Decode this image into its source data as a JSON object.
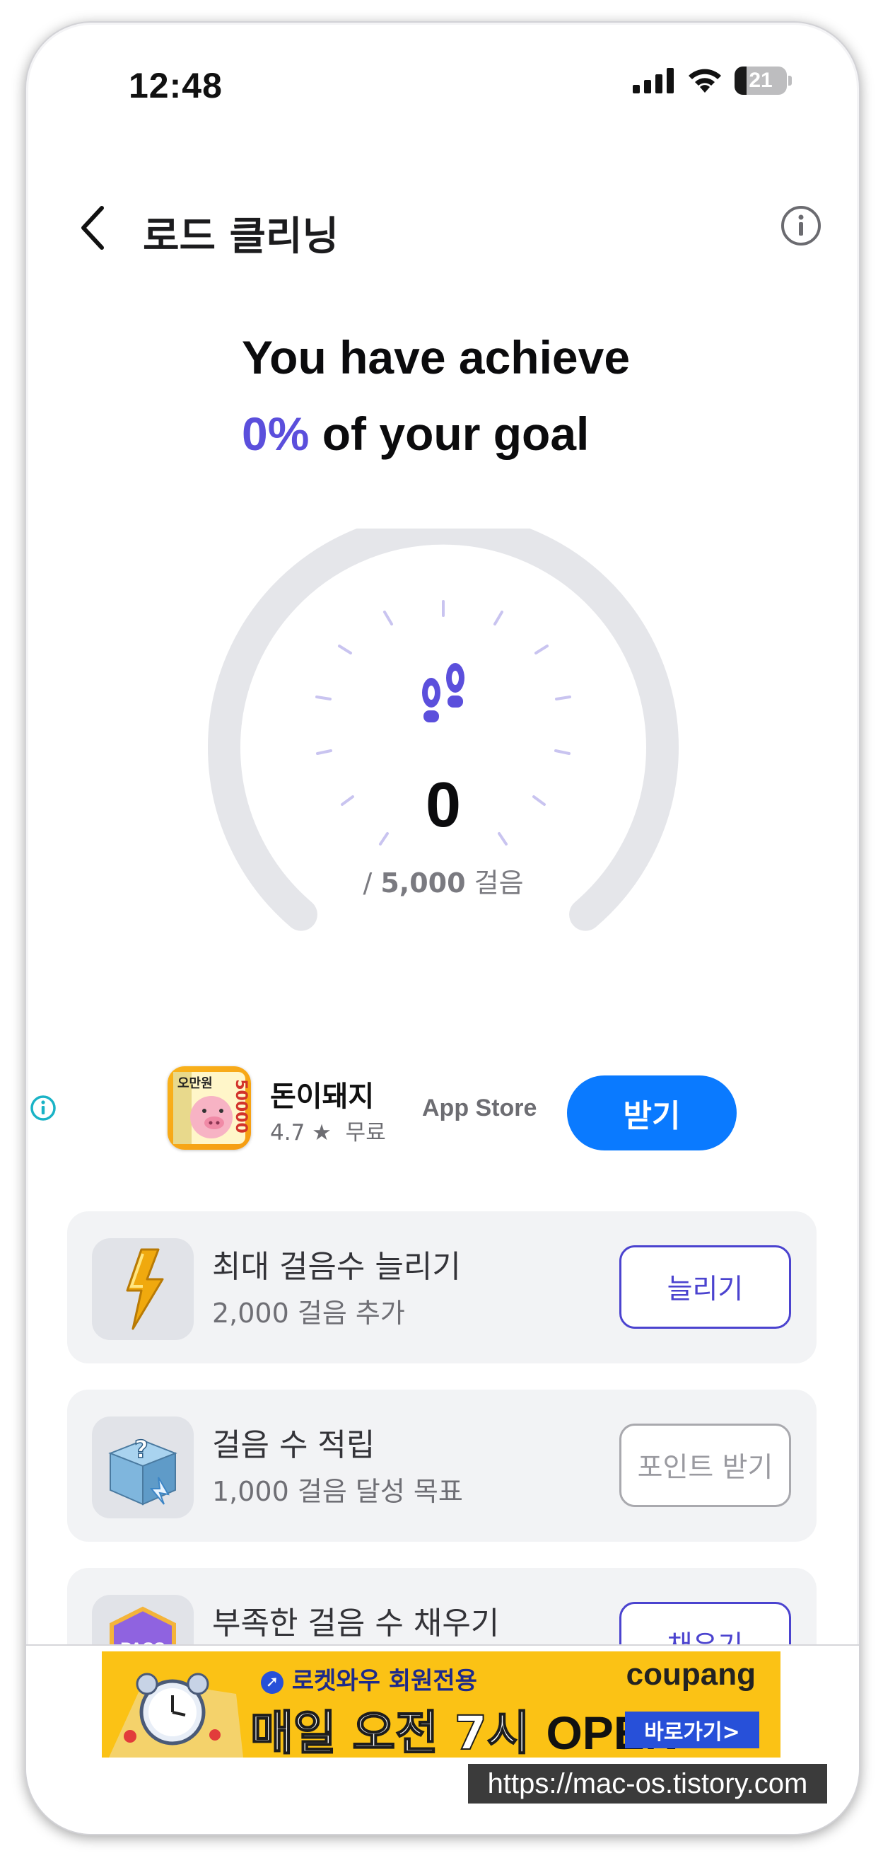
{
  "status": {
    "time": "12:48",
    "battery": "21"
  },
  "nav": {
    "title": "로드 클리닝"
  },
  "headline": {
    "line1": "You have achieve",
    "percent": "0%",
    "line2_rest": " of your goal"
  },
  "gauge": {
    "steps": "0",
    "goal_prefix": "/ ",
    "goal_value": "5,000",
    "goal_unit": " 걸음",
    "progress": 0
  },
  "ad": {
    "app_name": "돈이돼지",
    "rating": "4.7 ★",
    "price": "무료",
    "store": "App Store",
    "get_label": "받기",
    "icon_label_top": "오만원",
    "icon_label_side": "50000"
  },
  "cards": [
    {
      "title": "최대 걸음수 늘리기",
      "subtitle": "2,000 걸음 추가",
      "button": "늘리기",
      "icon": "lightning-icon"
    },
    {
      "title": "걸음 수 적립",
      "subtitle": "1,000 걸음 달성 목표",
      "button": "포인트 받기",
      "icon": "mystery-box-icon"
    },
    {
      "title": "부족한 걸음 수 채우기",
      "subtitle": "",
      "button": "채우기",
      "icon": "pass-badge-icon",
      "badge_text": "PASS"
    }
  ],
  "banner": {
    "top_text": "로켓와우 회원전용",
    "brand": "coupang",
    "main_text": "매일 오전 7시",
    "open": "OPEN",
    "cta": "바로가기>"
  },
  "watermark": "https://mac-os.tistory.com",
  "colors": {
    "accent": "#5b4fdc",
    "ad_button": "#0a7aff",
    "banner_bg": "#fbc215"
  }
}
